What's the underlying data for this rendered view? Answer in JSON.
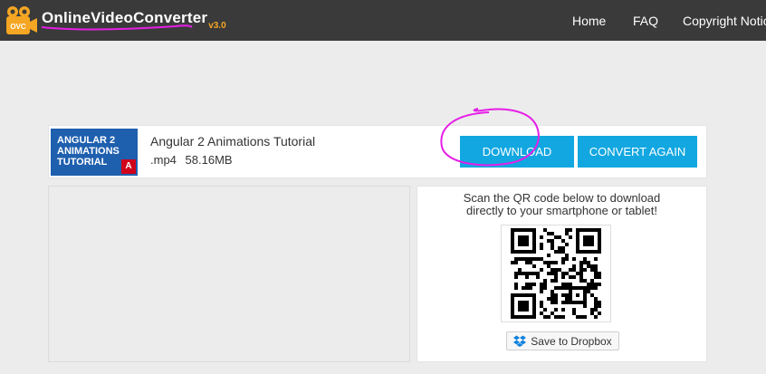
{
  "header": {
    "logo_badge": "OVC",
    "logo_word1": "Online",
    "logo_word2": "Video",
    "logo_word3": "Converter",
    "logo_version": "v3.0",
    "nav": {
      "home": "Home",
      "faq": "FAQ",
      "copyright": "Copyright Notic"
    },
    "colors": {
      "bar": "#3a3a3a",
      "accent": "#f5a623",
      "annotation": "#e61ee6"
    }
  },
  "result": {
    "thumbnail_line1": "Angular 2",
    "thumbnail_line2": "Animations",
    "thumbnail_line3": "Tutorial",
    "thumbnail_badge": "A",
    "title": "Angular 2 Animations Tutorial",
    "format": ".mp4",
    "size": "58.16MB",
    "download_label": "DOWNLOAD",
    "convert_again_label": "CONVERT AGAIN",
    "button_color": "#12a7e0"
  },
  "qr": {
    "line1": "Scan the QR code below to download",
    "line2": "directly to your smartphone or tablet!",
    "dropbox_label": "Save to Dropbox",
    "icon": "dropbox-icon"
  }
}
